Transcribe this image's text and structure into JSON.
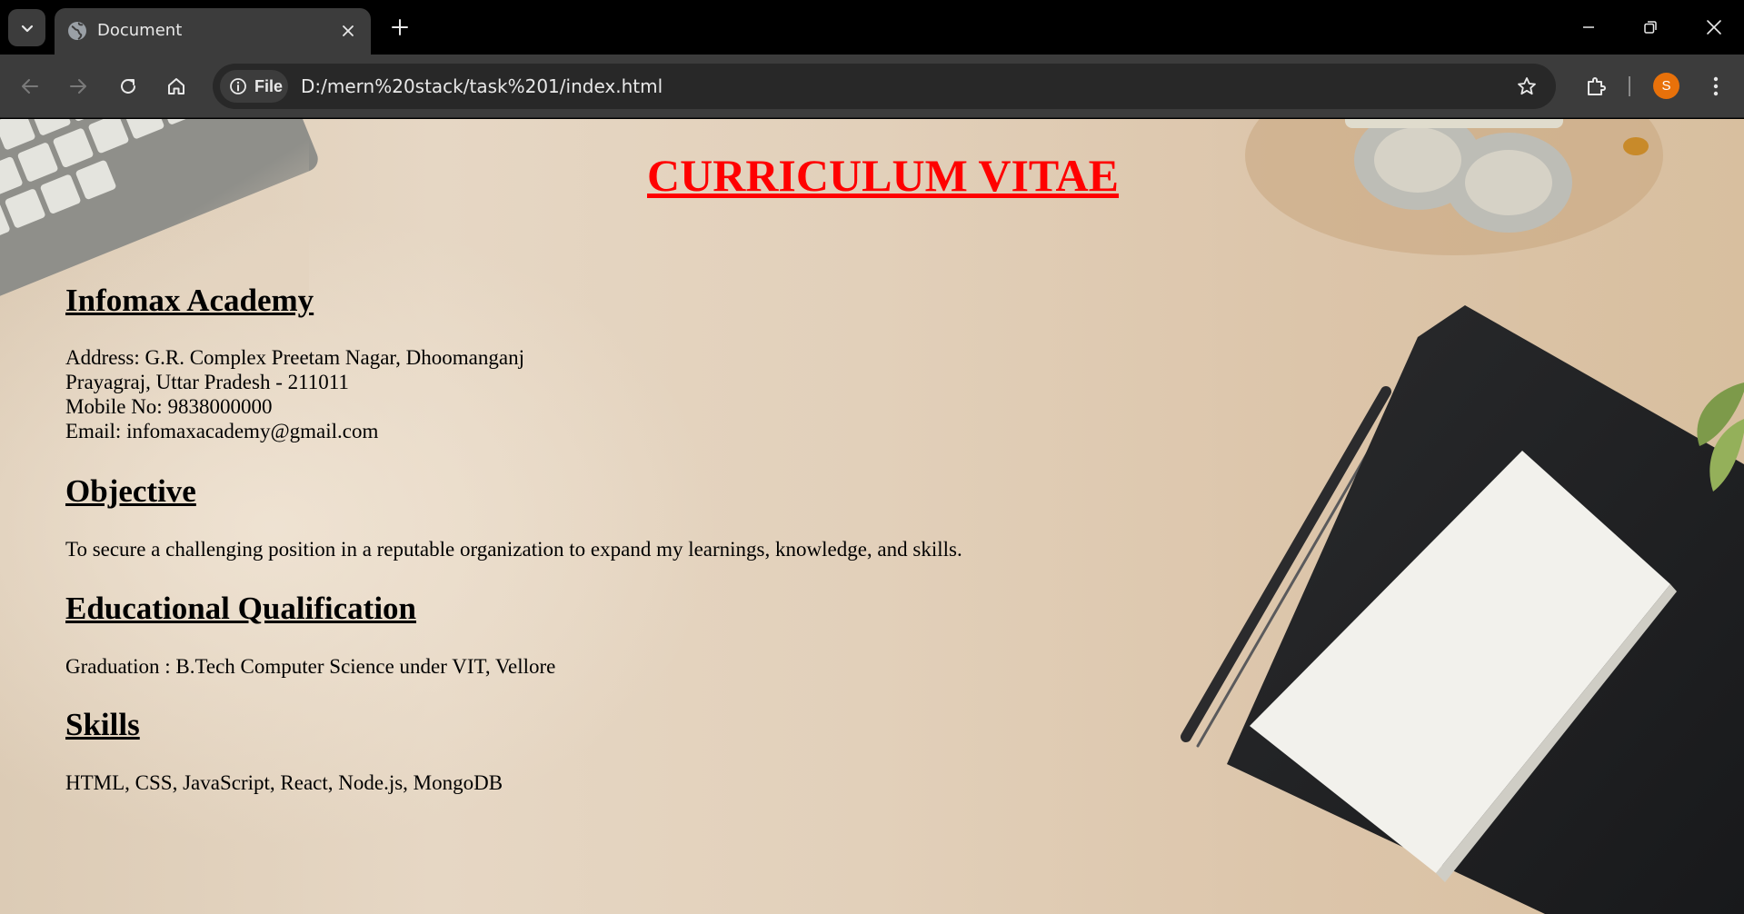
{
  "browser": {
    "tab": {
      "title": "Document"
    },
    "address_bar": {
      "chip_label": "File",
      "url": "D:/mern%20stack/task%201/index.html"
    },
    "profile_initial": "S"
  },
  "page": {
    "title": "CURRICULUM VITAE",
    "academy": {
      "heading": "Infomax Academy",
      "lines": [
        "Address: G.R. Complex Preetam Nagar, Dhoomanganj",
        "Prayagraj, Uttar Pradesh - 211011",
        "Mobile No: 9838000000",
        "Email: infomaxacademy@gmail.com"
      ]
    },
    "objective": {
      "heading": "Objective",
      "text": "To secure a challenging position in a reputable organization to expand my learnings, knowledge, and skills."
    },
    "education": {
      "heading": "Educational Qualification",
      "text": "Graduation : B.Tech Computer Science under VIT, Vellore"
    },
    "skills": {
      "heading": "Skills",
      "text": "HTML, CSS, JavaScript, React, Node.js, MongoDB"
    }
  },
  "colors": {
    "title_red": "#ff0000",
    "chrome_dark": "#3c3c3c",
    "avatar_orange": "#e8710a"
  }
}
